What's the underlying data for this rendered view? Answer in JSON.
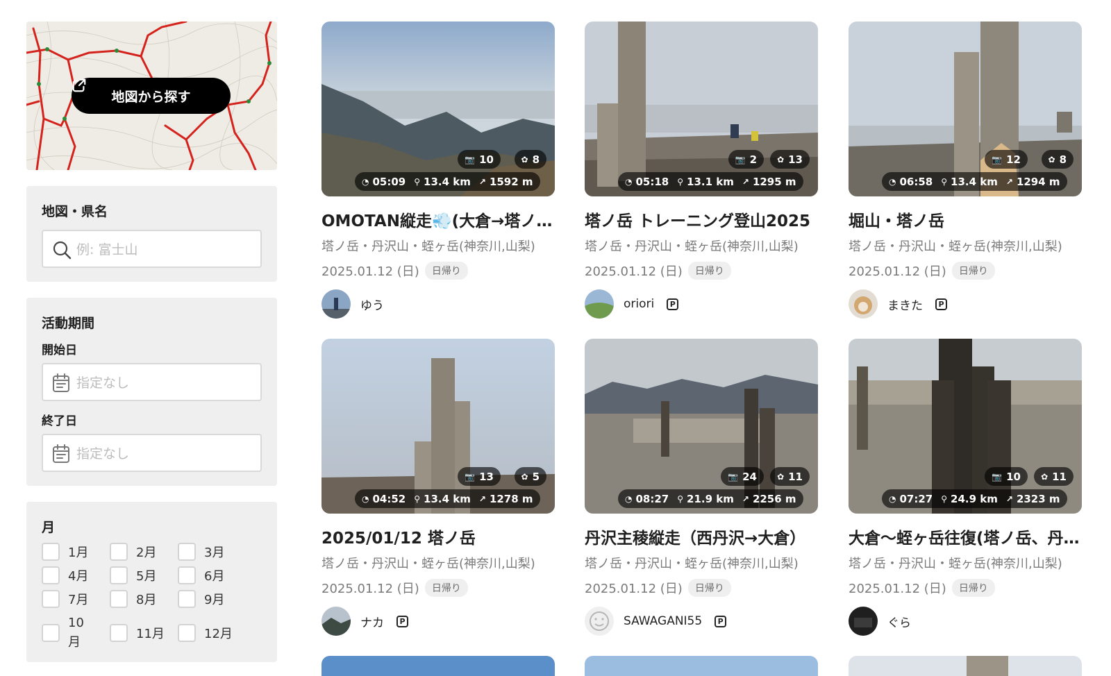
{
  "sidebar": {
    "map_button": "地図から探す",
    "region": {
      "heading": "地図・県名",
      "placeholder": "例: 富士山"
    },
    "period": {
      "heading": "活動期間",
      "start_label": "開始日",
      "end_label": "終了日",
      "start_placeholder": "指定なし",
      "end_placeholder": "指定なし"
    },
    "month": {
      "heading": "月",
      "items": [
        "1月",
        "2月",
        "3月",
        "4月",
        "5月",
        "6月",
        "7月",
        "8月",
        "9月",
        "10月",
        "11月",
        "12月"
      ]
    }
  },
  "cards": [
    {
      "title": "OMOTAN縦走💨(大倉→塔ノ岳→丹沢山→蛭ヶ岳)",
      "area": "塔ノ岳・丹沢山・蛭ヶ岳(神奈川,山梨)",
      "date": "2025.01.12 (日)",
      "badge": "日帰り",
      "user": "ゆう",
      "premium": false,
      "photos": "10",
      "clips": "8",
      "time": "05:09",
      "distance": "13.4 km",
      "ascent": "1592 m"
    },
    {
      "title": "塔ノ岳 トレーニング登山2025",
      "area": "塔ノ岳・丹沢山・蛭ヶ岳(神奈川,山梨)",
      "date": "2025.01.12 (日)",
      "badge": "日帰り",
      "user": "oriori",
      "premium": true,
      "photos": "2",
      "clips": "13",
      "time": "05:18",
      "distance": "13.1 km",
      "ascent": "1295 m"
    },
    {
      "title": "堀山・塔ノ岳",
      "area": "塔ノ岳・丹沢山・蛭ヶ岳(神奈川,山梨)",
      "date": "2025.01.12 (日)",
      "badge": "日帰り",
      "user": "まきた",
      "premium": true,
      "photos": "12",
      "clips": "8",
      "time": "06:58",
      "distance": "13.4 km",
      "ascent": "1294 m"
    },
    {
      "title": "2025/01/12 塔ノ岳",
      "area": "塔ノ岳・丹沢山・蛭ヶ岳(神奈川,山梨)",
      "date": "2025.01.12 (日)",
      "badge": "日帰り",
      "user": "ナカ",
      "premium": true,
      "photos": "13",
      "clips": "5",
      "time": "04:52",
      "distance": "13.4 km",
      "ascent": "1278 m"
    },
    {
      "title": "丹沢主稜縦走（西丹沢→大倉）",
      "area": "塔ノ岳・丹沢山・蛭ヶ岳(神奈川,山梨)",
      "date": "2025.01.12 (日)",
      "badge": "日帰り",
      "user": "SAWAGANI55",
      "premium": true,
      "photos": "24",
      "clips": "11",
      "time": "08:27",
      "distance": "21.9 km",
      "ascent": "2256 m"
    },
    {
      "title": "大倉〜蛭ヶ岳往復(塔ノ岳、丹沢山)",
      "area": "塔ノ岳・丹沢山・蛭ヶ岳(神奈川,山梨)",
      "date": "2025.01.12 (日)",
      "badge": "日帰り",
      "user": "ぐら",
      "premium": false,
      "photos": "10",
      "clips": "11",
      "time": "07:27",
      "distance": "24.9 km",
      "ascent": "2323 m"
    }
  ],
  "icons": {
    "camera": "camera-icon",
    "clip": "clip-icon",
    "clock": "clock-icon",
    "distance": "footprint-icon",
    "ascent": "ascent-icon",
    "search": "search-icon",
    "calendar": "calendar-icon",
    "external": "external-link-icon"
  }
}
